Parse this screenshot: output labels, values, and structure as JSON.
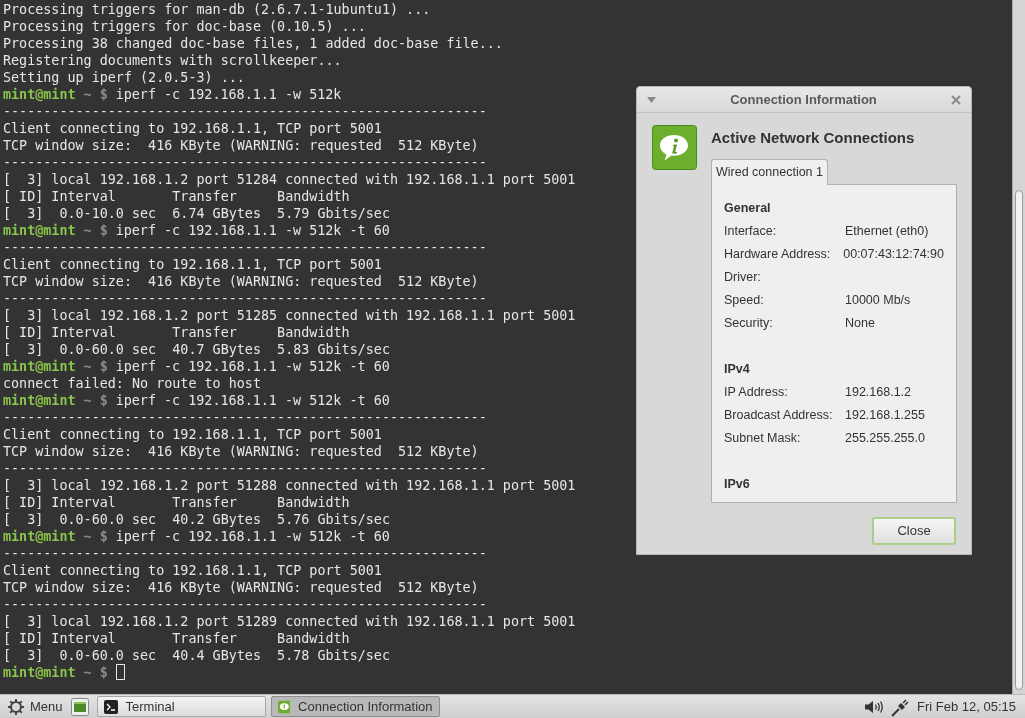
{
  "terminal": {
    "lines": [
      {
        "kind": "output",
        "text": "Processing triggers for man-db (2.6.7.1-1ubuntu1) ..."
      },
      {
        "kind": "output",
        "text": "Processing triggers for doc-base (0.10.5) ..."
      },
      {
        "kind": "output",
        "text": "Processing 38 changed doc-base files, 1 added doc-base file..."
      },
      {
        "kind": "output",
        "text": "Registering documents with scrollkeeper..."
      },
      {
        "kind": "output",
        "text": "Setting up iperf (2.0.5-3) ..."
      },
      {
        "kind": "prompt",
        "user": "mint@mint",
        "path": "~",
        "symbol": "$",
        "command": "iperf -c 192.168.1.1 -w 512k"
      },
      {
        "kind": "output",
        "text": "------------------------------------------------------------"
      },
      {
        "kind": "output",
        "text": "Client connecting to 192.168.1.1, TCP port 5001"
      },
      {
        "kind": "output",
        "text": "TCP window size:  416 KByte (WARNING: requested  512 KByte)"
      },
      {
        "kind": "output",
        "text": "------------------------------------------------------------"
      },
      {
        "kind": "output",
        "text": "[  3] local 192.168.1.2 port 51284 connected with 192.168.1.1 port 5001"
      },
      {
        "kind": "output",
        "text": "[ ID] Interval       Transfer     Bandwidth"
      },
      {
        "kind": "output",
        "text": "[  3]  0.0-10.0 sec  6.74 GBytes  5.79 Gbits/sec"
      },
      {
        "kind": "prompt",
        "user": "mint@mint",
        "path": "~",
        "symbol": "$",
        "command": "iperf -c 192.168.1.1 -w 512k -t 60"
      },
      {
        "kind": "output",
        "text": "------------------------------------------------------------"
      },
      {
        "kind": "output",
        "text": "Client connecting to 192.168.1.1, TCP port 5001"
      },
      {
        "kind": "output",
        "text": "TCP window size:  416 KByte (WARNING: requested  512 KByte)"
      },
      {
        "kind": "output",
        "text": "------------------------------------------------------------"
      },
      {
        "kind": "output",
        "text": "[  3] local 192.168.1.2 port 51285 connected with 192.168.1.1 port 5001"
      },
      {
        "kind": "output",
        "text": "[ ID] Interval       Transfer     Bandwidth"
      },
      {
        "kind": "output",
        "text": "[  3]  0.0-60.0 sec  40.7 GBytes  5.83 Gbits/sec"
      },
      {
        "kind": "prompt",
        "user": "mint@mint",
        "path": "~",
        "symbol": "$",
        "command": "iperf -c 192.168.1.1 -w 512k -t 60"
      },
      {
        "kind": "output",
        "text": "connect failed: No route to host"
      },
      {
        "kind": "prompt",
        "user": "mint@mint",
        "path": "~",
        "symbol": "$",
        "command": "iperf -c 192.168.1.1 -w 512k -t 60"
      },
      {
        "kind": "output",
        "text": "------------------------------------------------------------"
      },
      {
        "kind": "output",
        "text": "Client connecting to 192.168.1.1, TCP port 5001"
      },
      {
        "kind": "output",
        "text": "TCP window size:  416 KByte (WARNING: requested  512 KByte)"
      },
      {
        "kind": "output",
        "text": "------------------------------------------------------------"
      },
      {
        "kind": "output",
        "text": "[  3] local 192.168.1.2 port 51288 connected with 192.168.1.1 port 5001"
      },
      {
        "kind": "output",
        "text": "[ ID] Interval       Transfer     Bandwidth"
      },
      {
        "kind": "output",
        "text": "[  3]  0.0-60.0 sec  40.2 GBytes  5.76 Gbits/sec"
      },
      {
        "kind": "prompt",
        "user": "mint@mint",
        "path": "~",
        "symbol": "$",
        "command": "iperf -c 192.168.1.1 -w 512k -t 60"
      },
      {
        "kind": "output",
        "text": "------------------------------------------------------------"
      },
      {
        "kind": "output",
        "text": "Client connecting to 192.168.1.1, TCP port 5001"
      },
      {
        "kind": "output",
        "text": "TCP window size:  416 KByte (WARNING: requested  512 KByte)"
      },
      {
        "kind": "output",
        "text": "------------------------------------------------------------"
      },
      {
        "kind": "output",
        "text": "[  3] local 192.168.1.2 port 51289 connected with 192.168.1.1 port 5001"
      },
      {
        "kind": "output",
        "text": "[ ID] Interval       Transfer     Bandwidth"
      },
      {
        "kind": "output",
        "text": "[  3]  0.0-60.0 sec  40.4 GBytes  5.78 Gbits/sec"
      },
      {
        "kind": "prompt",
        "user": "mint@mint",
        "path": "~",
        "symbol": "$",
        "cursor": true
      }
    ]
  },
  "dialog": {
    "title": "Connection Information",
    "heading": "Active Network Connections",
    "tabs": [
      {
        "label": "Wired connection 1",
        "selected": true
      }
    ],
    "sections": [
      {
        "title": "General",
        "rows": [
          {
            "label": "Interface:",
            "value": "Ethernet (eth0)"
          },
          {
            "label": "Hardware Address:",
            "value": "00:07:43:12:74:90"
          },
          {
            "label": "Driver:"
          },
          {
            "label": "Speed:",
            "value": "10000 Mb/s"
          },
          {
            "label": "Security:",
            "value": "None"
          }
        ]
      },
      {
        "title": "IPv4",
        "rows": [
          {
            "label": "IP Address:",
            "value": "192.168.1.2"
          },
          {
            "label": "Broadcast Address:",
            "value": "192.168.1.255"
          },
          {
            "label": "Subnet Mask:",
            "value": "255.255.255.0"
          }
        ]
      },
      {
        "title": "IPv6"
      }
    ],
    "buttons": [
      "Close"
    ]
  },
  "taskbar": {
    "menu_label": "Menu",
    "windows": [
      {
        "label": "Terminal",
        "kind": "terminal",
        "selected": false
      },
      {
        "label": "Connection Information",
        "kind": "info",
        "selected": true
      }
    ],
    "clock": "Fri Feb 12, 05:15"
  }
}
